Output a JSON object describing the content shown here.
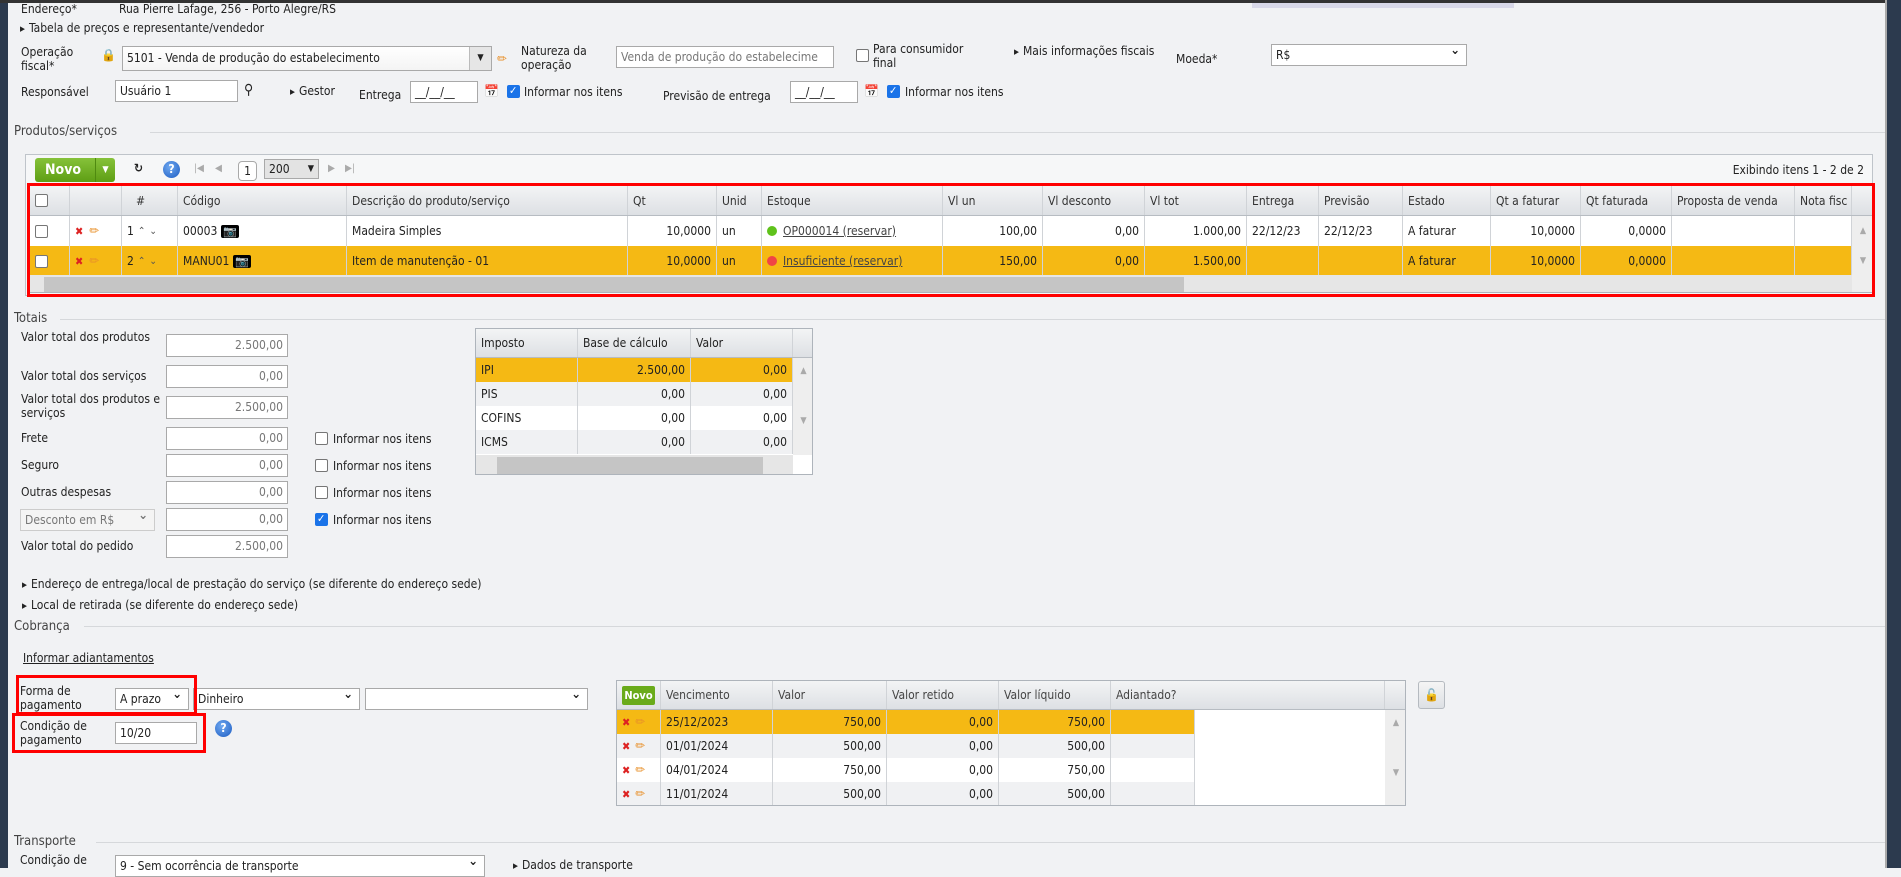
{
  "header": {
    "address_label": "Endereço*",
    "address_value": "Rua Pierre Lafage, 256 - Porto Alegre/RS",
    "price_table_toggle": "Tabela de preços e representante/vendedor",
    "fiscal_op_label": "Operação fiscal*",
    "fiscal_op_value": "5101 - Venda de produção do estabelecimento",
    "nature_label": "Natureza da operação",
    "nature_value": "Venda de produção do estabelecime",
    "final_consumer_label": "Para consumidor final",
    "final_consumer_checked": false,
    "more_fiscal": "Mais informações fiscais",
    "currency_label": "Moeda*",
    "currency_value": "R$",
    "responsible_label": "Responsável",
    "responsible_value": "Usuário 1",
    "manager_toggle": "Gestor",
    "delivery_label": "Entrega",
    "delivery_value": "__/__/__",
    "delivery_items_label": "Informar nos itens",
    "forecast_label": "Previsão de entrega",
    "forecast_value": "__/__/__",
    "forecast_items_label": "Informar nos itens"
  },
  "products": {
    "section_title": "Produtos/serviços",
    "new_button": "Novo",
    "page": "1",
    "page_size": "200",
    "showing": "Exibindo itens 1 - 2 de 2",
    "columns": [
      "#",
      "Código",
      "Descrição do produto/serviço",
      "Qt",
      "Unid",
      "Estoque",
      "Vl un",
      "Vl desconto",
      "Vl tot",
      "Entrega",
      "Previsão",
      "Estado",
      "Qt a faturar",
      "Qt faturada",
      "Proposta de venda",
      "Nota fisc"
    ],
    "rows": [
      {
        "num": "1",
        "code": "00003",
        "desc": "Madeira Simples",
        "qt": "10,0000",
        "unit": "un",
        "stock": "OP000014 (reservar)",
        "stock_status": "green",
        "vl_un": "100,00",
        "vl_desc": "0,00",
        "vl_tot": "1.000,00",
        "entrega": "22/12/23",
        "previsao": "22/12/23",
        "estado": "A faturar",
        "qt_fat": "10,0000",
        "qt_faturada": "0,0000",
        "proposta": "",
        "nota": ""
      },
      {
        "num": "2",
        "code": "MANU01",
        "desc": "Item de manutenção - 01",
        "qt": "10,0000",
        "unit": "un",
        "stock": "Insuficiente (reservar)",
        "stock_status": "red",
        "vl_un": "150,00",
        "vl_desc": "0,00",
        "vl_tot": "1.500,00",
        "entrega": "",
        "previsao": "",
        "estado": "A faturar",
        "qt_fat": "10,0000",
        "qt_faturada": "0,0000",
        "proposta": "",
        "nota": ""
      }
    ]
  },
  "totals": {
    "section_title": "Totais",
    "items_label": "Informar nos itens",
    "products_label": "Valor total dos produtos",
    "products": "2.500,00",
    "services_label": "Valor total dos serviços",
    "services": "0,00",
    "both_label": "Valor total dos produtos e serviços",
    "both": "2.500,00",
    "freight_label": "Frete",
    "freight": "0,00",
    "insurance_label": "Seguro",
    "insurance": "0,00",
    "other_label": "Outras despesas",
    "other": "0,00",
    "discount_type": "Desconto em R$",
    "discount": "0,00",
    "order_label": "Valor total do pedido",
    "order": "2.500,00",
    "tax_columns": [
      "Imposto",
      "Base de cálculo",
      "Valor"
    ],
    "taxes": [
      {
        "name": "IPI",
        "base": "2.500,00",
        "value": "0,00"
      },
      {
        "name": "PIS",
        "base": "0,00",
        "value": "0,00"
      },
      {
        "name": "COFINS",
        "base": "0,00",
        "value": "0,00"
      },
      {
        "name": "ICMS",
        "base": "0,00",
        "value": "0,00"
      }
    ],
    "delivery_address_toggle": "Endereço de entrega/local de prestação do serviço (se diferente do endereço sede)",
    "pickup_toggle": "Local de retirada (se diferente do endereço sede)"
  },
  "billing": {
    "section_title": "Cobrança",
    "advances_link": "Informar adiantamentos",
    "payment_form_label": "Forma de pagamento",
    "payment_form": "A prazo",
    "payment_method": "Dinheiro",
    "payment_extra": "",
    "condition_label": "Condição de pagamento",
    "condition": "10/20",
    "new_button": "Novo",
    "columns": [
      "Vencimento",
      "Valor",
      "Valor retido",
      "Valor líquido",
      "Adiantado?"
    ],
    "installments": [
      {
        "due": "25/12/2023",
        "value": "750,00",
        "retained": "0,00",
        "net": "750,00",
        "adv": ""
      },
      {
        "due": "01/01/2024",
        "value": "500,00",
        "retained": "0,00",
        "net": "500,00",
        "adv": ""
      },
      {
        "due": "04/01/2024",
        "value": "750,00",
        "retained": "0,00",
        "net": "750,00",
        "adv": ""
      },
      {
        "due": "11/01/2024",
        "value": "500,00",
        "retained": "0,00",
        "net": "500,00",
        "adv": ""
      }
    ]
  },
  "transport": {
    "section_title": "Transporte",
    "condition_label": "Condição de",
    "condition": "9 - Sem ocorrência de transporte",
    "data_toggle": "Dados de transporte"
  },
  "colors": {
    "highlight": "#f5b914",
    "accent_green": "#6aab1a",
    "annotation": "#ff0000"
  }
}
